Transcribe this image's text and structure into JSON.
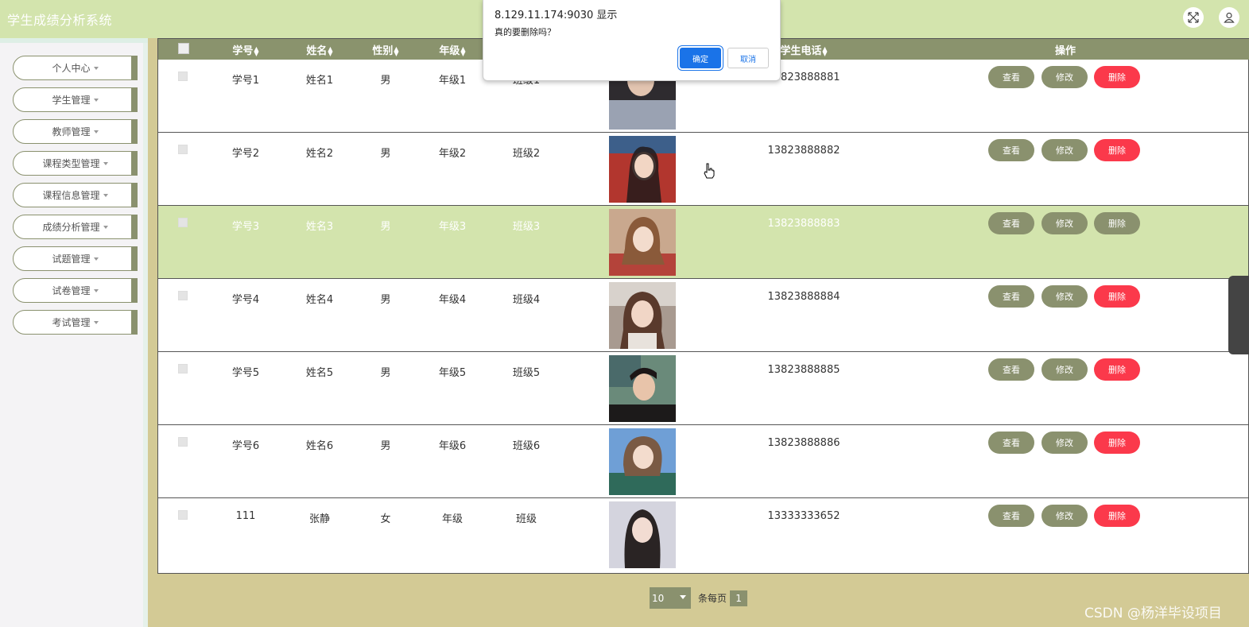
{
  "app": {
    "title": "学生成绩分析系统"
  },
  "topbar": {
    "fullscreen_icon": "expand-icon",
    "user_icon": "user-icon"
  },
  "sidebar": {
    "items": [
      {
        "label": "个人中心"
      },
      {
        "label": "学生管理"
      },
      {
        "label": "教师管理"
      },
      {
        "label": "课程类型管理"
      },
      {
        "label": "课程信息管理"
      },
      {
        "label": "成绩分析管理"
      },
      {
        "label": "试题管理"
      },
      {
        "label": "试卷管理"
      },
      {
        "label": "考试管理"
      }
    ]
  },
  "table": {
    "headers": {
      "id": "学号",
      "name": "姓名",
      "gender": "性别",
      "grade": "年级",
      "phone": "学生电话",
      "actions": "操作"
    },
    "rows": [
      {
        "id": "学号1",
        "name": "姓名1",
        "gender": "男",
        "grade": "年级1",
        "class": "班级1",
        "phone": "13823888881"
      },
      {
        "id": "学号2",
        "name": "姓名2",
        "gender": "男",
        "grade": "年级2",
        "class": "班级2",
        "phone": "13823888882"
      },
      {
        "id": "学号3",
        "name": "姓名3",
        "gender": "男",
        "grade": "年级3",
        "class": "班级3",
        "phone": "13823888883"
      },
      {
        "id": "学号4",
        "name": "姓名4",
        "gender": "男",
        "grade": "年级4",
        "class": "班级4",
        "phone": "13823888884"
      },
      {
        "id": "学号5",
        "name": "姓名5",
        "gender": "男",
        "grade": "年级5",
        "class": "班级5",
        "phone": "13823888885"
      },
      {
        "id": "学号6",
        "name": "姓名6",
        "gender": "男",
        "grade": "年级6",
        "class": "班级6",
        "phone": "13823888886"
      },
      {
        "id": "111",
        "name": "张静",
        "gender": "女",
        "grade": "年级",
        "class": "班级",
        "phone": "13333333652"
      }
    ],
    "highlighted_row": 3,
    "buttons": {
      "view": "查看",
      "edit": "修改",
      "delete": "删除"
    }
  },
  "pagination": {
    "page_size": "10",
    "per_page_label": "条每页",
    "current_page": "1"
  },
  "dialog": {
    "origin": "8.129.11.174:9030 显示",
    "message": "真的要删除吗？",
    "ok": "确定",
    "cancel": "取消"
  },
  "watermark": "CSDN @杨洋毕设项目",
  "colors": {
    "topbar": "#d3e4ad",
    "header": "#8a936d",
    "button": "#8a916e",
    "delete": "#fb394b",
    "background": "#d3ca95"
  }
}
